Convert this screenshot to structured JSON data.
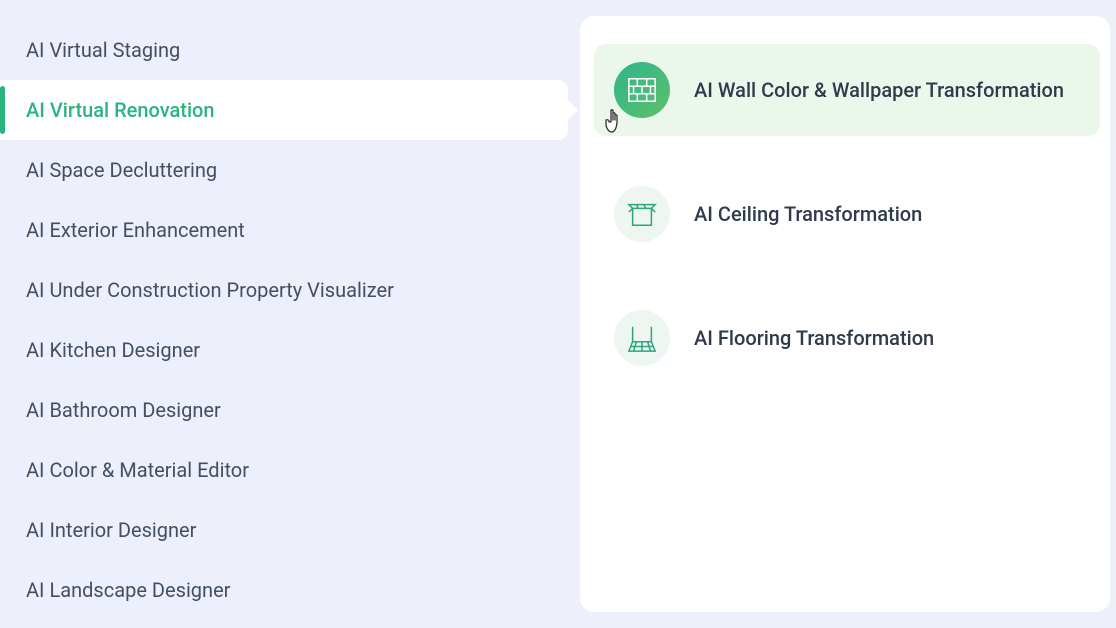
{
  "sidebar": {
    "items": [
      {
        "label": "AI Virtual Staging",
        "active": false
      },
      {
        "label": "AI Virtual Renovation",
        "active": true
      },
      {
        "label": "AI Space Decluttering",
        "active": false
      },
      {
        "label": "AI Exterior Enhancement",
        "active": false
      },
      {
        "label": "AI Under Construction Property Visualizer",
        "active": false
      },
      {
        "label": "AI Kitchen Designer",
        "active": false
      },
      {
        "label": "AI Bathroom Designer",
        "active": false
      },
      {
        "label": "AI Color & Material Editor",
        "active": false
      },
      {
        "label": "AI Interior Designer",
        "active": false
      },
      {
        "label": "AI Landscape Designer",
        "active": false
      }
    ]
  },
  "subpanel": {
    "items": [
      {
        "label": "AI Wall Color & Wallpaper Transformation",
        "highlight": true,
        "icon": "brick-wall-icon"
      },
      {
        "label": "AI Ceiling Transformation",
        "highlight": false,
        "icon": "ceiling-icon"
      },
      {
        "label": "AI Flooring Transformation",
        "highlight": false,
        "icon": "flooring-icon"
      }
    ]
  }
}
